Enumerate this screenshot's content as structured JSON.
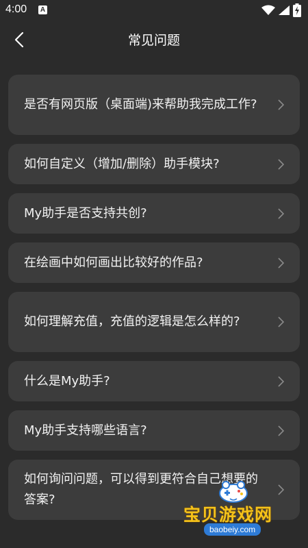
{
  "status_bar": {
    "time": "4:00",
    "notification_icon": "A",
    "icons": [
      "wifi-icon",
      "signal-icon",
      "battery-charging-icon"
    ]
  },
  "nav": {
    "title": "常见问题",
    "back_icon": "chevron-left-icon"
  },
  "faq": {
    "items": [
      {
        "label": "是否有网页版（桌面端)来帮助我完成工作?"
      },
      {
        "label": "如何自定义（增加/删除）助手模块?"
      },
      {
        "label": "My助手是否支持共创?"
      },
      {
        "label": "在绘画中如何画出比较好的作品?"
      },
      {
        "label": "如何理解充值，充值的逻辑是怎么样的?"
      },
      {
        "label": "什么是My助手?"
      },
      {
        "label": "My助手支持哪些语言?"
      },
      {
        "label": "如何询问问题，可以得到更符合自己想要的答案?"
      }
    ]
  },
  "watermark": {
    "title": "宝贝游戏网",
    "url": "baobeiy.com"
  },
  "colors": {
    "background": "#2b2b2b",
    "card": "#3c3c3c",
    "text": "#f2f2f2",
    "chevron": "#8a8a8a",
    "watermark_gold": "#f4c21a",
    "watermark_blue": "#2e7bd6"
  }
}
